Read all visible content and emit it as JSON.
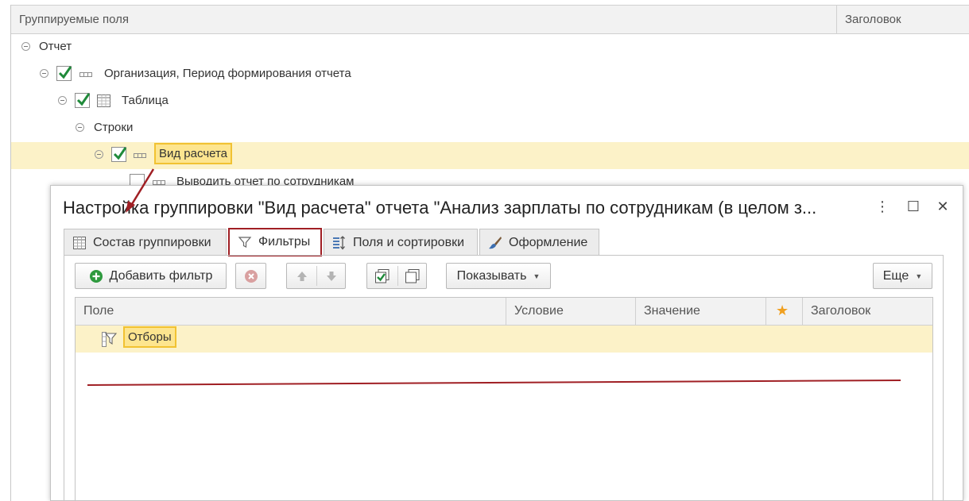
{
  "background_grid": {
    "col_fields": "Группируемые поля",
    "col_header": "Заголовок",
    "rows": [
      {
        "label": "Отчет"
      },
      {
        "label": "Организация, Период формирования отчета"
      },
      {
        "label": "Таблица"
      },
      {
        "label": "Строки"
      },
      {
        "label": "Вид расчета"
      },
      {
        "label": "Выводить отчет по сотрудникам"
      }
    ]
  },
  "dialog": {
    "title": "Настройка группировки \"Вид расчета\" отчета \"Анализ зарплаты по сотрудникам (в целом з...",
    "more_icon": "⋮",
    "maximize_icon": "☐",
    "close_icon": "✕",
    "tabs": [
      {
        "label": "Состав группировки",
        "icon": "table-icon"
      },
      {
        "label": "Фильтры",
        "icon": "filter-icon",
        "active": true
      },
      {
        "label": "Поля и сортировки",
        "icon": "sort-icon"
      },
      {
        "label": "Оформление",
        "icon": "brush-icon"
      }
    ],
    "toolbar": {
      "add_filter": "Добавить фильтр",
      "show": "Показывать",
      "more": "Еще"
    },
    "filter_grid": {
      "columns": [
        "Поле",
        "Условие",
        "Значение",
        "★",
        "Заголовок"
      ],
      "rows": [
        {
          "label": "Отборы"
        }
      ]
    }
  },
  "colors": {
    "accent_red": "#a01f24",
    "selection": "#fcf2c8",
    "highlight_border": "#f1c232",
    "check_green": "#1f8a3a"
  }
}
